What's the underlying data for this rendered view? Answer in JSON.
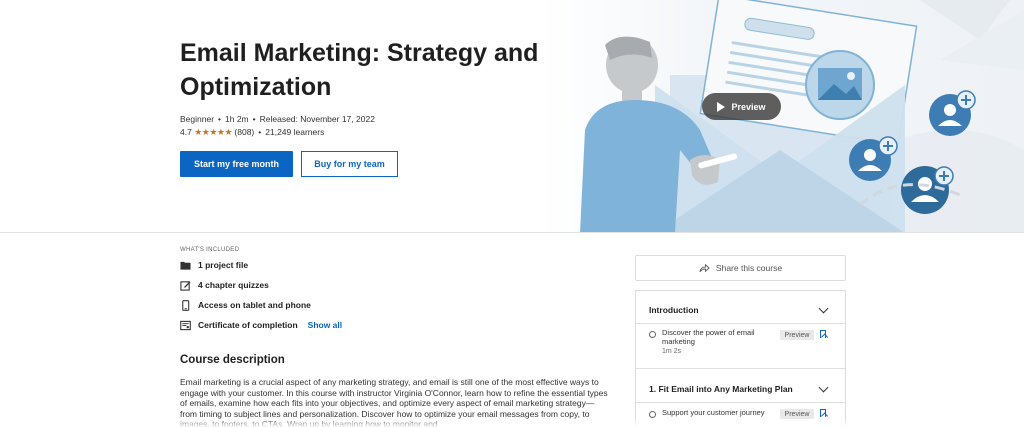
{
  "hero": {
    "title": "Email Marketing: Strategy and Optimization",
    "level": "Beginner",
    "duration": "1h 2m",
    "released": "Released: November 17, 2022",
    "rating": "4.7",
    "stars": "★★★★★",
    "reviews": "(808)",
    "learners": "21,249 learners",
    "primary_cta": "Start my free month",
    "secondary_cta": "Buy for my team",
    "preview_label": "Preview",
    "accent_color": "#0a66c2",
    "star_color": "#c6762a"
  },
  "included": {
    "heading": "WHAT'S INCLUDED",
    "items": [
      {
        "icon": "folder-icon",
        "label": "1 project file"
      },
      {
        "icon": "edit-icon",
        "label": "4 chapter quizzes"
      },
      {
        "icon": "mobile-icon",
        "label": "Access on tablet and phone"
      },
      {
        "icon": "certificate-icon",
        "label": "Certificate of completion"
      }
    ],
    "show_all": "Show all"
  },
  "description": {
    "heading": "Course description",
    "body": "Email marketing is a crucial aspect of any marketing strategy, and email is still one of the most effective ways to engage with your customer. In this course with instructor Virginia O'Connor, learn how to refine the essential types of emails, examine how each fits into your objectives, and optimize every aspect of email marketing strategy—from timing to subject lines and personalization. Discover how to optimize your email messages from copy, to images, to footers, to CTAs. Wrap up by learning how to monitor and"
  },
  "sidebar": {
    "share": "Share this course",
    "toc": [
      {
        "section": "Introduction",
        "videos": [
          {
            "title": "Discover the power of email marketing",
            "duration": "1m 2s",
            "badge": "Preview"
          }
        ]
      },
      {
        "section": "1. Fit Email into Any Marketing Plan",
        "videos": [
          {
            "title": "Support your customer journey",
            "duration": "",
            "badge": "Preview"
          }
        ]
      }
    ]
  }
}
